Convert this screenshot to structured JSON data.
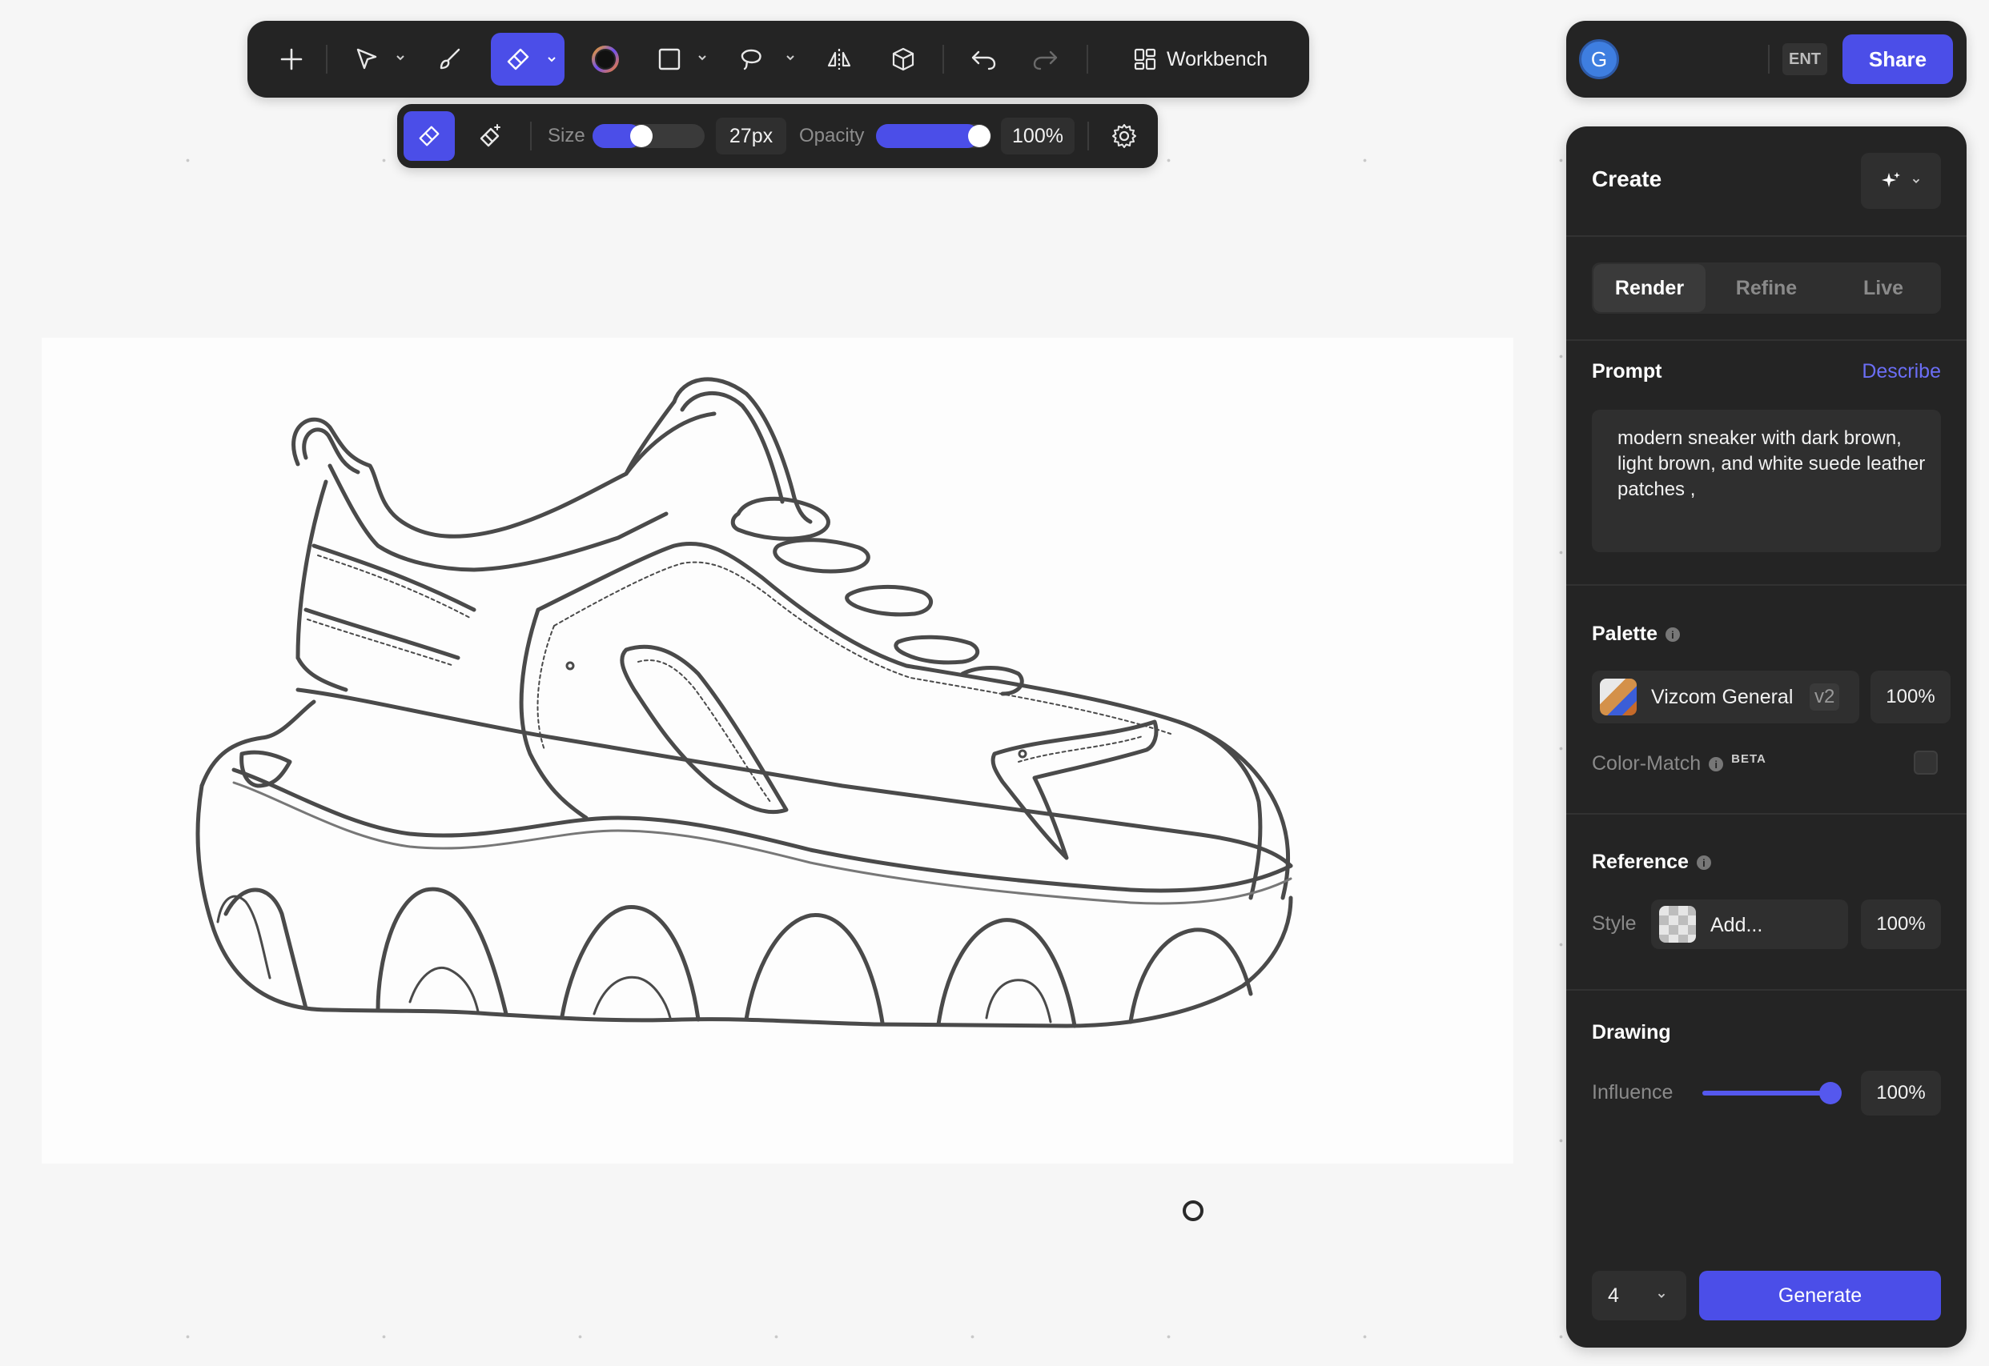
{
  "toolbar": {
    "workbench_label": "Workbench"
  },
  "subtoolbar": {
    "size_label": "Size",
    "size_value": "27px",
    "size_level": 0.42,
    "opacity_label": "Opacity",
    "opacity_value": "100%",
    "opacity_level": 1.0
  },
  "topright": {
    "avatar_initial": "G",
    "plan_badge": "ENT",
    "share_label": "Share"
  },
  "panel": {
    "title": "Create",
    "tabs": [
      {
        "label": "Render",
        "active": true
      },
      {
        "label": "Refine",
        "active": false
      },
      {
        "label": "Live",
        "active": false
      }
    ],
    "prompt": {
      "label": "Prompt",
      "action": "Describe",
      "text": "modern sneaker with dark brown, light brown, and white suede leather patches ,"
    },
    "palette": {
      "label": "Palette",
      "name": "Vizcom General",
      "version": "v2",
      "strength": "100%",
      "color_match_label": "Color-Match",
      "color_match_badge": "BETA",
      "color_match_checked": false
    },
    "reference": {
      "label": "Reference",
      "style_label": "Style",
      "add_label": "Add...",
      "strength": "100%"
    },
    "drawing": {
      "label": "Drawing",
      "influence_label": "Influence",
      "influence_value": "100%",
      "influence_level": 1.0
    },
    "generate": {
      "count": "4",
      "label": "Generate"
    }
  },
  "colors": {
    "accent": "#4b4ee8",
    "panel_bg": "#242424",
    "canvas_bg": "#f6f6f6"
  }
}
